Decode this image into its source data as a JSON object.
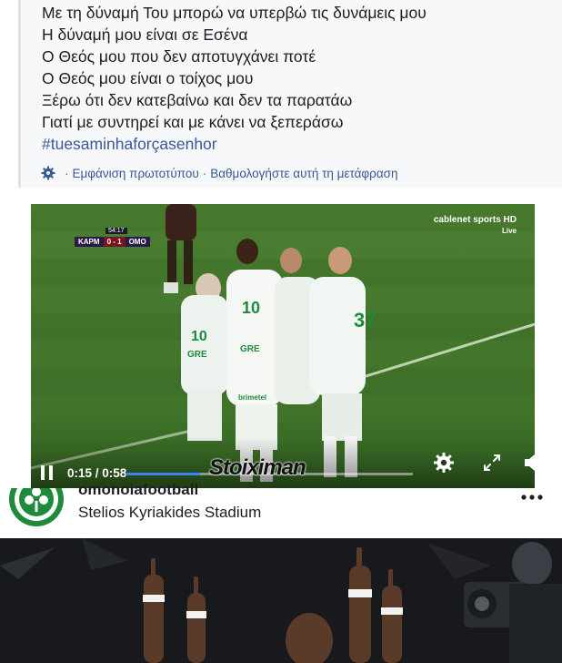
{
  "post": {
    "lines": [
      "Με τη δύναμή Του μπορώ να υπερβώ τις δυνάμεις μου",
      "Η δύναμή μου είναι σε Εσένα",
      "Ο Θεός μου που δεν αποτυγχάνει ποτέ",
      "Ο Θεός μου είναι ο τοίχος μου",
      "Ξέρω ότι δεν κατεβαίνω και δεν τα παρατάω",
      "Γιατί με συντηρεί και με κάνει να ξεπεράσω"
    ],
    "hashtag": "#tuesaminhaforçasenhor",
    "see_original": "Εμφάνιση πρωτοτύπου",
    "separator": "·",
    "rate_translation": "Βαθμολογήστε αυτή τη μετάφραση",
    "link_color": "#385898"
  },
  "video": {
    "scoreboard": {
      "home": "ΚΑΡΜ",
      "score": "0 - 1",
      "away": "ΟΜΟ",
      "clock": "54:17"
    },
    "broadcaster": "cablenet sports HD",
    "live": "Live",
    "current_time": "0:15",
    "duration": "0:58",
    "time_display": "0:15 / 0:58",
    "progress": 0.26,
    "sponsor": "Stoiximan",
    "progress_color": "#3b82f6",
    "icons": [
      "pause-icon",
      "settings-gear-icon",
      "fullscreen-icon",
      "volume-muted-icon"
    ]
  },
  "next_post": {
    "page_name_partial": "omonoiafootball",
    "location": "Stelios Kyriakides Stadium",
    "more_icon": "more-options-icon",
    "brand_color": "#1f8a3a"
  }
}
